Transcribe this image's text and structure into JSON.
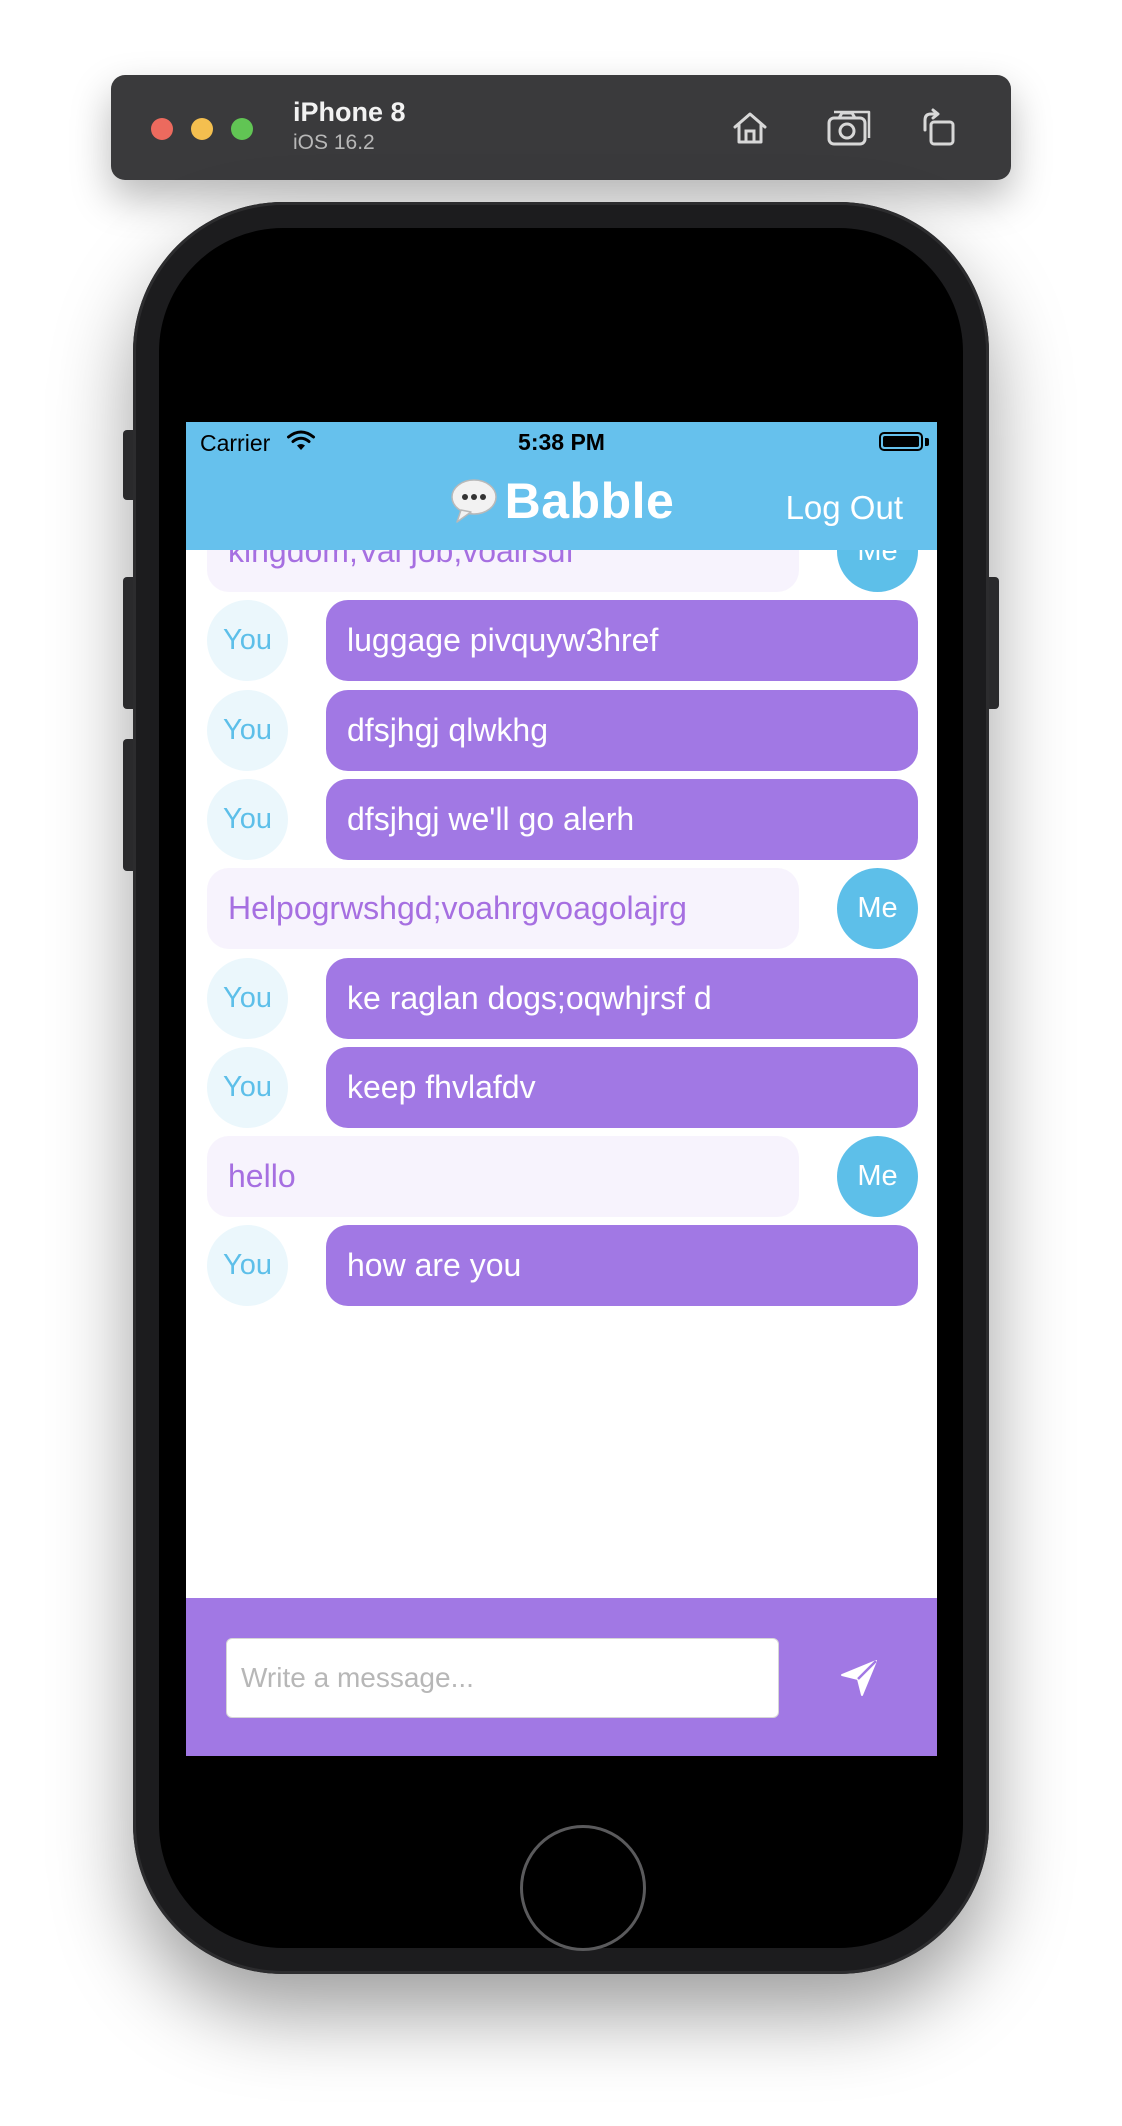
{
  "simulator": {
    "device_name": "iPhone 8",
    "os_version": "iOS 16.2",
    "buttons": {
      "home_icon": "home-icon",
      "screenshot_icon": "camera-icon",
      "rotate_icon": "rotate-icon"
    }
  },
  "status_bar": {
    "carrier": "Carrier",
    "time": "5:38 PM"
  },
  "nav": {
    "title": "Babble",
    "logo_icon": "speech-bubble-icon",
    "logout_label": "Log Out"
  },
  "messages": [
    {
      "sender": "me",
      "avatar": "Me",
      "text": "kingdom;Val job;voairsdf"
    },
    {
      "sender": "you",
      "avatar": "You",
      "text": "luggage pivquyw3href"
    },
    {
      "sender": "you",
      "avatar": "You",
      "text": "dfsjhgj qlwkhg"
    },
    {
      "sender": "you",
      "avatar": "You",
      "text": "dfsjhgj we'll go alerh"
    },
    {
      "sender": "me",
      "avatar": "Me",
      "text": "Helpogrwshgd;voahrgvoagolajrg"
    },
    {
      "sender": "you",
      "avatar": "You",
      "text": "ke raglan dogs;oqwhjrsf d"
    },
    {
      "sender": "you",
      "avatar": "You",
      "text": "keep fhvlafdv"
    },
    {
      "sender": "me",
      "avatar": "Me",
      "text": "hello"
    },
    {
      "sender": "you",
      "avatar": "You",
      "text": "how are you"
    }
  ],
  "composer": {
    "placeholder": "Write a message...",
    "value": "",
    "send_icon": "send-icon"
  },
  "colors": {
    "header": "#66c1ed",
    "accent_purple": "#a178e4",
    "me_bubble": "#f7f3fd",
    "me_text": "#a66fe1",
    "you_avatar_bg": "#ebf7fc",
    "avatar_blue": "#5dbfe9"
  }
}
